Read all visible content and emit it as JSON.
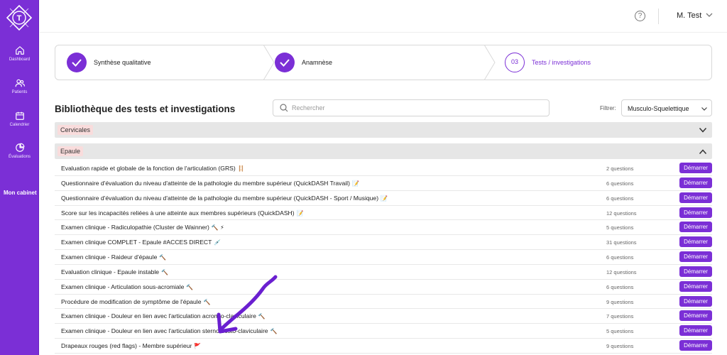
{
  "sidebar": {
    "logo_letter": "T",
    "items": [
      {
        "label": "Dashboard",
        "icon": "home-icon"
      },
      {
        "label": "Patients",
        "icon": "users-icon"
      },
      {
        "label": "Calendrier",
        "icon": "calendar-icon"
      },
      {
        "label": "Évaluations",
        "icon": "pie-chart-icon"
      }
    ],
    "cabinet_label": "Mon cabinet"
  },
  "topbar": {
    "help_icon": "?",
    "user_name": "M. Test"
  },
  "stepper": {
    "steps": [
      {
        "label": "Synthèse qualitative",
        "state": "done"
      },
      {
        "label": "Anamnèse",
        "state": "done"
      },
      {
        "label": "Tests / investigations",
        "state": "current",
        "number": "03"
      }
    ]
  },
  "library": {
    "title": "Bibliothèque des tests et investigations",
    "search_placeholder": "Rechercher",
    "filter_label": "Filtrer:",
    "filter_value": "Musculo-Squelettique"
  },
  "categories": [
    {
      "label": "Cervicales",
      "expanded": false
    },
    {
      "label": "Epaule",
      "expanded": true
    }
  ],
  "tests": [
    {
      "name": "Evaluation rapide et globale de la fonction de l'articulation (GRS)",
      "icon": "🪜",
      "count": "2 questions",
      "action": "Démarrer"
    },
    {
      "name": "Questionnaire d'évaluation du niveau d'atteinte de la pathologie du membre supérieur (QuickDASH Travail)",
      "icon": "📝",
      "count": "6 questions",
      "action": "Démarrer"
    },
    {
      "name": "Questionnaire d'évaluation du niveau d'atteinte de la pathologie du membre supérieur (QuickDASH - Sport / Musique)",
      "icon": "📝",
      "count": "6 questions",
      "action": "Démarrer"
    },
    {
      "name": "Score sur les incapacités reliées à une atteinte aux membres supérieurs (QuickDASH)",
      "icon": "📝",
      "count": "12 questions",
      "action": "Démarrer"
    },
    {
      "name": "Examen clinique - Radiculopathie (Cluster de Wainner)",
      "icon": "🔨 ⚡",
      "count": "5 questions",
      "action": "Démarrer"
    },
    {
      "name": "Examen clinique COMPLET - Epaule #ACCES DIRECT",
      "icon": "💉",
      "count": "31 questions",
      "action": "Démarrer"
    },
    {
      "name": "Examen clinique - Raideur d'épaule",
      "icon": "🔨",
      "count": "6 questions",
      "action": "Démarrer"
    },
    {
      "name": "Evaluation clinique - Epaule instable",
      "icon": "🔨",
      "count": "12 questions",
      "action": "Démarrer"
    },
    {
      "name": "Examen clinique - Articulation sous-acromiale",
      "icon": "🔨",
      "count": "6 questions",
      "action": "Démarrer"
    },
    {
      "name": "Procédure de modification de symptôme de l'épaule",
      "icon": "🔨",
      "count": "9 questions",
      "action": "Démarrer"
    },
    {
      "name": "Examen clinique - Douleur en lien avec l'articulation acromio-claviculaire",
      "icon": "🔨",
      "count": "7 questions",
      "action": "Démarrer"
    },
    {
      "name": "Examen clinique - Douleur en lien avec l'articulation sterno-costo-claviculaire",
      "icon": "🔨",
      "count": "5 questions",
      "action": "Démarrer"
    },
    {
      "name": "Drapeaux rouges (red flags) - Membre supérieur",
      "icon": "🚩",
      "count": "9 questions",
      "action": "Démarrer"
    }
  ],
  "colors": {
    "accent": "#7b2fd6",
    "category_bar": "#e6e6e6",
    "category_tag": "#f9dcdc",
    "annotation_arrow": "#6a1fd0"
  }
}
